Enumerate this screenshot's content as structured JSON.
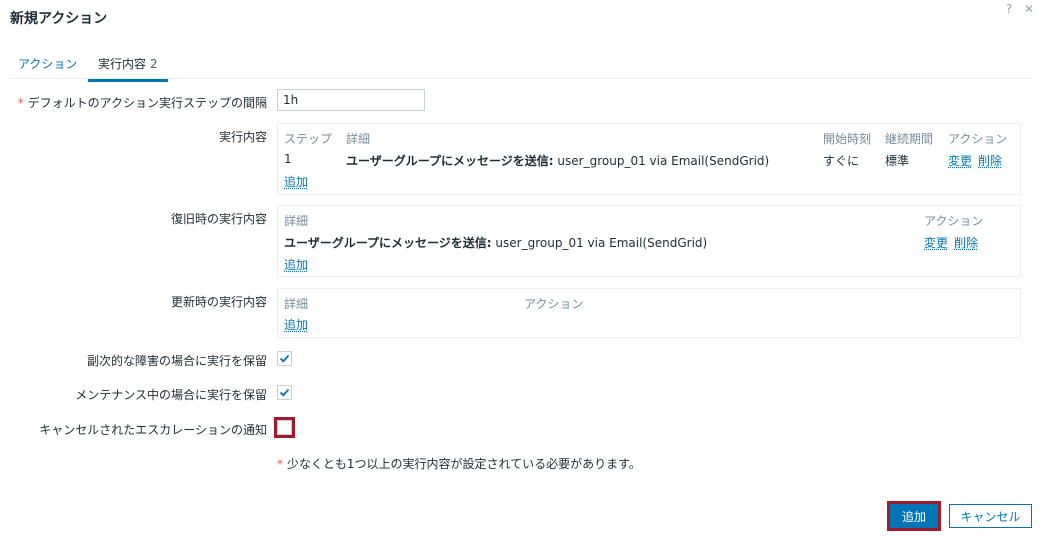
{
  "dialog": {
    "title": "新規アクション",
    "help_icon": "?",
    "close_icon": "✕"
  },
  "tabs": [
    {
      "label": "アクション",
      "count": ""
    },
    {
      "label": "実行内容",
      "count": "2"
    }
  ],
  "form": {
    "default_step_label": "デフォルトのアクション実行ステップの間隔",
    "default_step_required": "*",
    "default_step_value": "1h",
    "operations": {
      "label": "実行内容",
      "headers": {
        "steps": "ステップ",
        "details": "詳細",
        "start_in": "開始時刻",
        "duration": "継続期間",
        "action": "アクション"
      },
      "row": {
        "step": "1",
        "detail_bold": "ユーザーグループにメッセージを送信:",
        "detail_rest": " user_group_01 via Email(SendGrid)",
        "start_in": "すぐに",
        "duration": "標準",
        "edit": "変更",
        "remove": "削除"
      },
      "add": "追加"
    },
    "recovery": {
      "label": "復旧時の実行内容",
      "headers": {
        "details": "詳細",
        "action": "アクション"
      },
      "row": {
        "detail_bold": "ユーザーグループにメッセージを送信:",
        "detail_rest": " user_group_01 via Email(SendGrid)",
        "edit": "変更",
        "remove": "削除"
      },
      "add": "追加"
    },
    "update": {
      "label": "更新時の実行内容",
      "headers": {
        "details": "詳細",
        "action": "アクション"
      },
      "add": "追加"
    },
    "pause_symptoms": {
      "label": "副次的な障害の場合に実行を保留",
      "checked": true
    },
    "pause_maintenance": {
      "label": "メンテナンス中の場合に実行を保留",
      "checked": true
    },
    "notify_cancelled": {
      "label": "キャンセルされたエスカレーションの通知",
      "checked": false
    },
    "note_required": "*",
    "note_text": " 少なくとも1つ以上の実行内容が設定されている必要があります。"
  },
  "buttons": {
    "add": "追加",
    "cancel": "キャンセル"
  }
}
